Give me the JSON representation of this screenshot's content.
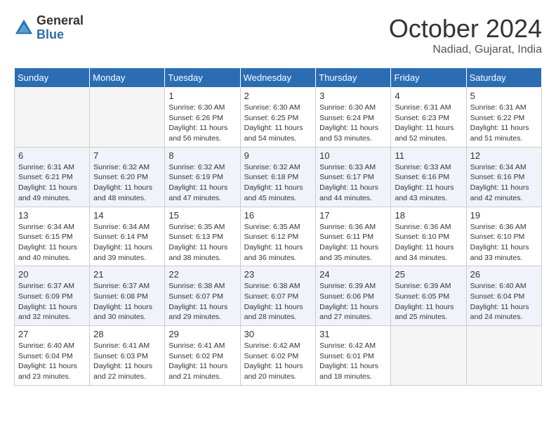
{
  "header": {
    "logo_general": "General",
    "logo_blue": "Blue",
    "month_title": "October 2024",
    "location": "Nadiad, Gujarat, India"
  },
  "weekdays": [
    "Sunday",
    "Monday",
    "Tuesday",
    "Wednesday",
    "Thursday",
    "Friday",
    "Saturday"
  ],
  "weeks": [
    [
      {
        "day": "",
        "empty": true
      },
      {
        "day": "",
        "empty": true
      },
      {
        "day": "1",
        "sunrise": "Sunrise: 6:30 AM",
        "sunset": "Sunset: 6:26 PM",
        "daylight": "Daylight: 11 hours and 56 minutes."
      },
      {
        "day": "2",
        "sunrise": "Sunrise: 6:30 AM",
        "sunset": "Sunset: 6:25 PM",
        "daylight": "Daylight: 11 hours and 54 minutes."
      },
      {
        "day": "3",
        "sunrise": "Sunrise: 6:30 AM",
        "sunset": "Sunset: 6:24 PM",
        "daylight": "Daylight: 11 hours and 53 minutes."
      },
      {
        "day": "4",
        "sunrise": "Sunrise: 6:31 AM",
        "sunset": "Sunset: 6:23 PM",
        "daylight": "Daylight: 11 hours and 52 minutes."
      },
      {
        "day": "5",
        "sunrise": "Sunrise: 6:31 AM",
        "sunset": "Sunset: 6:22 PM",
        "daylight": "Daylight: 11 hours and 51 minutes."
      }
    ],
    [
      {
        "day": "6",
        "sunrise": "Sunrise: 6:31 AM",
        "sunset": "Sunset: 6:21 PM",
        "daylight": "Daylight: 11 hours and 49 minutes."
      },
      {
        "day": "7",
        "sunrise": "Sunrise: 6:32 AM",
        "sunset": "Sunset: 6:20 PM",
        "daylight": "Daylight: 11 hours and 48 minutes."
      },
      {
        "day": "8",
        "sunrise": "Sunrise: 6:32 AM",
        "sunset": "Sunset: 6:19 PM",
        "daylight": "Daylight: 11 hours and 47 minutes."
      },
      {
        "day": "9",
        "sunrise": "Sunrise: 6:32 AM",
        "sunset": "Sunset: 6:18 PM",
        "daylight": "Daylight: 11 hours and 45 minutes."
      },
      {
        "day": "10",
        "sunrise": "Sunrise: 6:33 AM",
        "sunset": "Sunset: 6:17 PM",
        "daylight": "Daylight: 11 hours and 44 minutes."
      },
      {
        "day": "11",
        "sunrise": "Sunrise: 6:33 AM",
        "sunset": "Sunset: 6:16 PM",
        "daylight": "Daylight: 11 hours and 43 minutes."
      },
      {
        "day": "12",
        "sunrise": "Sunrise: 6:34 AM",
        "sunset": "Sunset: 6:16 PM",
        "daylight": "Daylight: 11 hours and 42 minutes."
      }
    ],
    [
      {
        "day": "13",
        "sunrise": "Sunrise: 6:34 AM",
        "sunset": "Sunset: 6:15 PM",
        "daylight": "Daylight: 11 hours and 40 minutes."
      },
      {
        "day": "14",
        "sunrise": "Sunrise: 6:34 AM",
        "sunset": "Sunset: 6:14 PM",
        "daylight": "Daylight: 11 hours and 39 minutes."
      },
      {
        "day": "15",
        "sunrise": "Sunrise: 6:35 AM",
        "sunset": "Sunset: 6:13 PM",
        "daylight": "Daylight: 11 hours and 38 minutes."
      },
      {
        "day": "16",
        "sunrise": "Sunrise: 6:35 AM",
        "sunset": "Sunset: 6:12 PM",
        "daylight": "Daylight: 11 hours and 36 minutes."
      },
      {
        "day": "17",
        "sunrise": "Sunrise: 6:36 AM",
        "sunset": "Sunset: 6:11 PM",
        "daylight": "Daylight: 11 hours and 35 minutes."
      },
      {
        "day": "18",
        "sunrise": "Sunrise: 6:36 AM",
        "sunset": "Sunset: 6:10 PM",
        "daylight": "Daylight: 11 hours and 34 minutes."
      },
      {
        "day": "19",
        "sunrise": "Sunrise: 6:36 AM",
        "sunset": "Sunset: 6:10 PM",
        "daylight": "Daylight: 11 hours and 33 minutes."
      }
    ],
    [
      {
        "day": "20",
        "sunrise": "Sunrise: 6:37 AM",
        "sunset": "Sunset: 6:09 PM",
        "daylight": "Daylight: 11 hours and 32 minutes."
      },
      {
        "day": "21",
        "sunrise": "Sunrise: 6:37 AM",
        "sunset": "Sunset: 6:08 PM",
        "daylight": "Daylight: 11 hours and 30 minutes."
      },
      {
        "day": "22",
        "sunrise": "Sunrise: 6:38 AM",
        "sunset": "Sunset: 6:07 PM",
        "daylight": "Daylight: 11 hours and 29 minutes."
      },
      {
        "day": "23",
        "sunrise": "Sunrise: 6:38 AM",
        "sunset": "Sunset: 6:07 PM",
        "daylight": "Daylight: 11 hours and 28 minutes."
      },
      {
        "day": "24",
        "sunrise": "Sunrise: 6:39 AM",
        "sunset": "Sunset: 6:06 PM",
        "daylight": "Daylight: 11 hours and 27 minutes."
      },
      {
        "day": "25",
        "sunrise": "Sunrise: 6:39 AM",
        "sunset": "Sunset: 6:05 PM",
        "daylight": "Daylight: 11 hours and 25 minutes."
      },
      {
        "day": "26",
        "sunrise": "Sunrise: 6:40 AM",
        "sunset": "Sunset: 6:04 PM",
        "daylight": "Daylight: 11 hours and 24 minutes."
      }
    ],
    [
      {
        "day": "27",
        "sunrise": "Sunrise: 6:40 AM",
        "sunset": "Sunset: 6:04 PM",
        "daylight": "Daylight: 11 hours and 23 minutes."
      },
      {
        "day": "28",
        "sunrise": "Sunrise: 6:41 AM",
        "sunset": "Sunset: 6:03 PM",
        "daylight": "Daylight: 11 hours and 22 minutes."
      },
      {
        "day": "29",
        "sunrise": "Sunrise: 6:41 AM",
        "sunset": "Sunset: 6:02 PM",
        "daylight": "Daylight: 11 hours and 21 minutes."
      },
      {
        "day": "30",
        "sunrise": "Sunrise: 6:42 AM",
        "sunset": "Sunset: 6:02 PM",
        "daylight": "Daylight: 11 hours and 20 minutes."
      },
      {
        "day": "31",
        "sunrise": "Sunrise: 6:42 AM",
        "sunset": "Sunset: 6:01 PM",
        "daylight": "Daylight: 11 hours and 18 minutes."
      },
      {
        "day": "",
        "empty": true
      },
      {
        "day": "",
        "empty": true
      }
    ]
  ]
}
